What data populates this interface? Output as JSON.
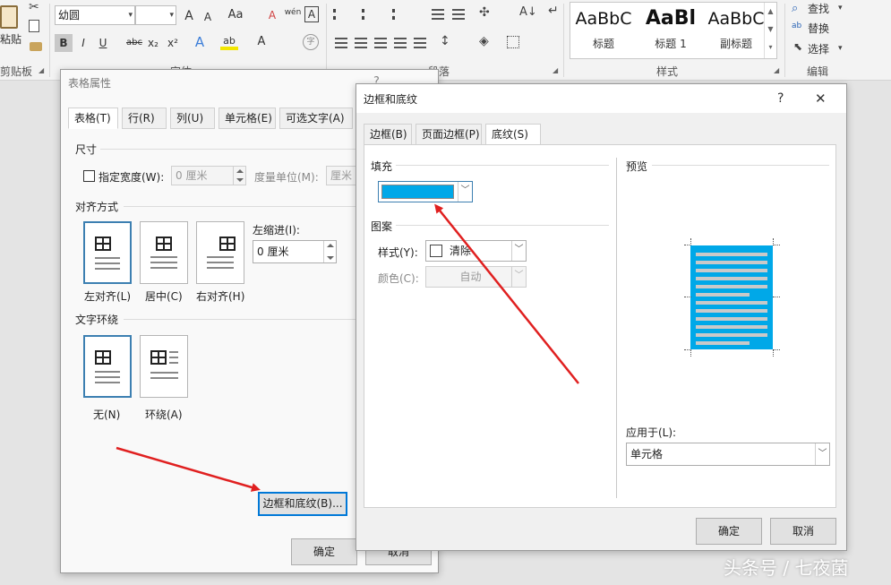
{
  "ribbon": {
    "clipboard": {
      "paste_label": "粘贴",
      "group_label": "剪贴板"
    },
    "font": {
      "font_name": "幼圆",
      "font_size": "",
      "grow_label": "A",
      "shrink_label": "A",
      "case_label": "Aa",
      "clear_label": "A",
      "phonetic_label": "wén",
      "border_char_label": "A",
      "bold": "B",
      "italic": "I",
      "underline": "U",
      "strike": "abc",
      "subscript": "x₂",
      "superscript": "x²",
      "effects_label": "A",
      "highlight_label": "ab",
      "color_label": "A",
      "enclose_label": "字",
      "group_label": "字体"
    },
    "paragraph": {
      "group_label": "段落"
    },
    "styles": {
      "items": [
        {
          "preview": "AaBbC",
          "name": "标题"
        },
        {
          "preview": "AaBl",
          "name": "标题 1"
        },
        {
          "preview": "AaBbC",
          "name": "副标题"
        }
      ],
      "group_label": "样式"
    },
    "editing": {
      "find": "查找",
      "replace": "替换",
      "select": "选择",
      "group_label": "编辑"
    }
  },
  "table_props": {
    "title": "表格属性",
    "help": "?",
    "tabs": [
      {
        "label": "表格(T)"
      },
      {
        "label": "行(R)"
      },
      {
        "label": "列(U)"
      },
      {
        "label": "单元格(E)"
      },
      {
        "label": "可选文字(A)"
      }
    ],
    "size_section": "尺寸",
    "preferred_width_label": "指定宽度(W):",
    "preferred_width_value": "0 厘米",
    "measure_label": "度量单位(M):",
    "measure_value": "厘米",
    "alignment_section": "对齐方式",
    "align_options": [
      {
        "label": "左对齐(L)"
      },
      {
        "label": "居中(C)"
      },
      {
        "label": "右对齐(H)"
      }
    ],
    "indent_label": "左缩进(I):",
    "indent_value": "0 厘米",
    "wrap_section": "文字环绕",
    "wrap_options": [
      {
        "label": "无(N)"
      },
      {
        "label": "环绕(A)"
      }
    ],
    "borders_button": "边框和底纹(B)...",
    "ok_button": "确定",
    "cancel_button": "取消"
  },
  "borders_dialog": {
    "title": "边框和底纹",
    "help": "?",
    "close": "✕",
    "tabs": [
      {
        "label": "边框(B)"
      },
      {
        "label": "页面边框(P)"
      },
      {
        "label": "底纹(S)"
      }
    ],
    "fill_section": "填充",
    "fill_color": "#00a8e8",
    "pattern_section": "图案",
    "style_label": "样式(Y):",
    "style_value": "清除",
    "color_label": "颜色(C):",
    "color_value": "自动",
    "preview_section": "预览",
    "apply_label": "应用于(L):",
    "apply_value": "单元格",
    "ok_button": "确定",
    "cancel_button": "取消"
  },
  "watermark": "头条号 / 七夜菌",
  "colors": {
    "arrow": "#e02020",
    "accent": "#0078d7"
  }
}
